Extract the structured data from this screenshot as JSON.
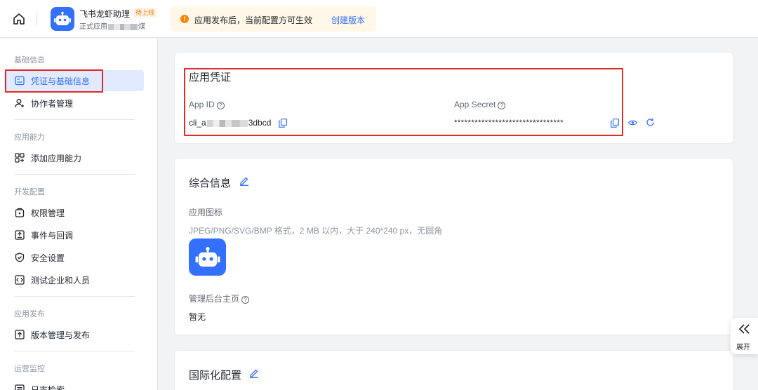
{
  "header": {
    "app_name": "飞书龙虾助理",
    "app_badge": "待上线",
    "app_sub_prefix": "正式应用",
    "app_sub_suffix": "煤",
    "notice_text": "应用发布后，当前配置方可生效",
    "notice_link": "创建版本",
    "notice_icon": "!"
  },
  "sidebar": {
    "sections": [
      {
        "label": "基础信息"
      },
      {
        "label": "应用能力"
      },
      {
        "label": "开发配置"
      },
      {
        "label": "应用发布"
      },
      {
        "label": "运营监控"
      }
    ],
    "items": [
      {
        "label": "凭证与基础信息",
        "icon": "credential-icon"
      },
      {
        "label": "协作者管理",
        "icon": "user-add-icon"
      },
      {
        "label": "添加应用能力",
        "icon": "apps-add-icon"
      },
      {
        "label": "权限管理",
        "icon": "permission-icon"
      },
      {
        "label": "事件与回调",
        "icon": "event-icon"
      },
      {
        "label": "安全设置",
        "icon": "shield-icon"
      },
      {
        "label": "测试企业和人员",
        "icon": "code-icon"
      },
      {
        "label": "版本管理与发布",
        "icon": "upload-icon"
      },
      {
        "label": "日志检索",
        "icon": "log-icon"
      }
    ]
  },
  "credentials": {
    "title": "应用凭证",
    "app_id_label": "App ID",
    "app_id_prefix": "cli_a",
    "app_id_suffix": "3dbcd",
    "app_secret_label": "App Secret",
    "app_secret_value": "********************************",
    "help_glyph": "?"
  },
  "general": {
    "title": "综合信息",
    "icon_label": "应用图标",
    "icon_hint": "JPEG/PNG/SVG/BMP 格式，2 MB 以内，大于 240*240 px，无圆角",
    "admin_label": "管理后台主页",
    "admin_value": "暂无"
  },
  "i18n": {
    "title": "国际化配置"
  },
  "expand": {
    "label": "展开"
  },
  "colors": {
    "primary": "#3370ff",
    "highlight_box": "#e02b2b",
    "warning": "#ff8800"
  }
}
